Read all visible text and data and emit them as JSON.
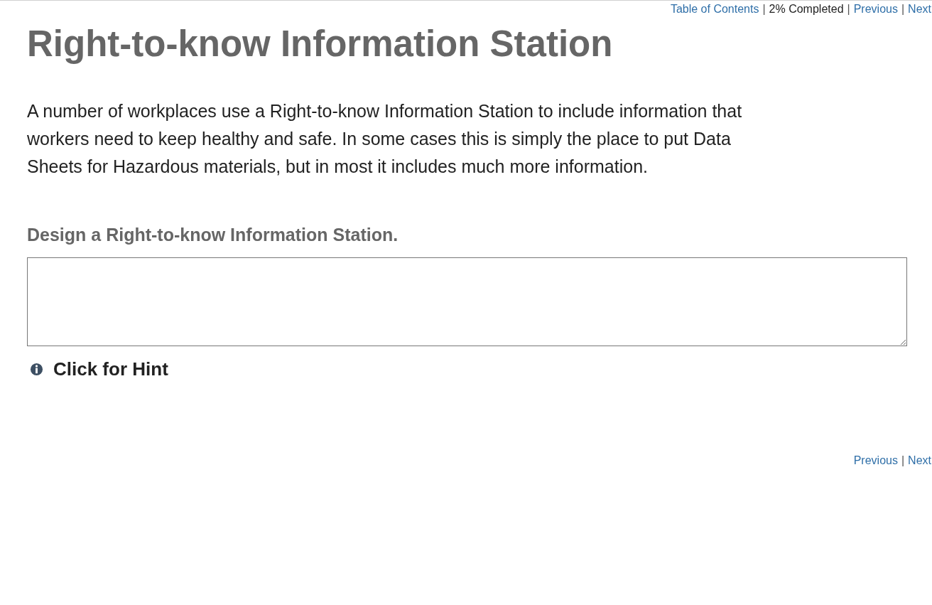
{
  "top_nav": [
    {
      "kind": "link",
      "text": "Table of Contents"
    },
    {
      "kind": "separator",
      "text": "|"
    },
    {
      "kind": "text",
      "text": "2% Completed"
    },
    {
      "kind": "separator",
      "text": "|"
    },
    {
      "kind": "link",
      "text": "Previous"
    },
    {
      "kind": "separator",
      "text": "|"
    },
    {
      "kind": "link",
      "text": "Next"
    }
  ],
  "title": "Right-to-know Information Station",
  "intro": "A number of workplaces use a Right-to-know Information Station to include information that workers need to keep healthy and safe. In some cases this is simply the place to put Data Sheets for Hazardous materials, but in most it includes much more information.",
  "question": {
    "prompt": "Design a Right-to-know Information Station.",
    "hint": "Click for Hint"
  },
  "bottom_nav": [
    {
      "kind": "link",
      "text": "Previous"
    },
    {
      "kind": "separator",
      "text": "|"
    },
    {
      "kind": "link",
      "text": "Next"
    }
  ]
}
